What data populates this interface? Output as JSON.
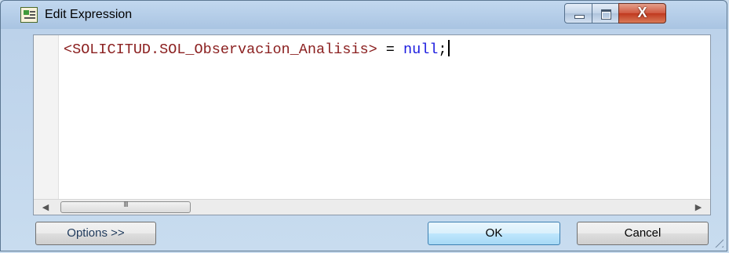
{
  "window": {
    "title": "Edit Expression",
    "icon": "expression-editor-icon",
    "controls": {
      "minimize": "minimize-icon",
      "maximize": "maximize-icon",
      "close_glyph": "X"
    }
  },
  "editor": {
    "code_field": "<SOLICITUD.SOL_Observacion_Analisis>",
    "code_operator": " = ",
    "code_keyword": "null",
    "code_terminator": ";",
    "scroll_thumb_glyph": "III"
  },
  "buttons": {
    "options_label": "Options >>",
    "ok_label": "OK",
    "cancel_label": "Cancel"
  },
  "colors": {
    "identifier": "#8b2020",
    "keyword": "#1a1adf",
    "operator": "#000000"
  }
}
